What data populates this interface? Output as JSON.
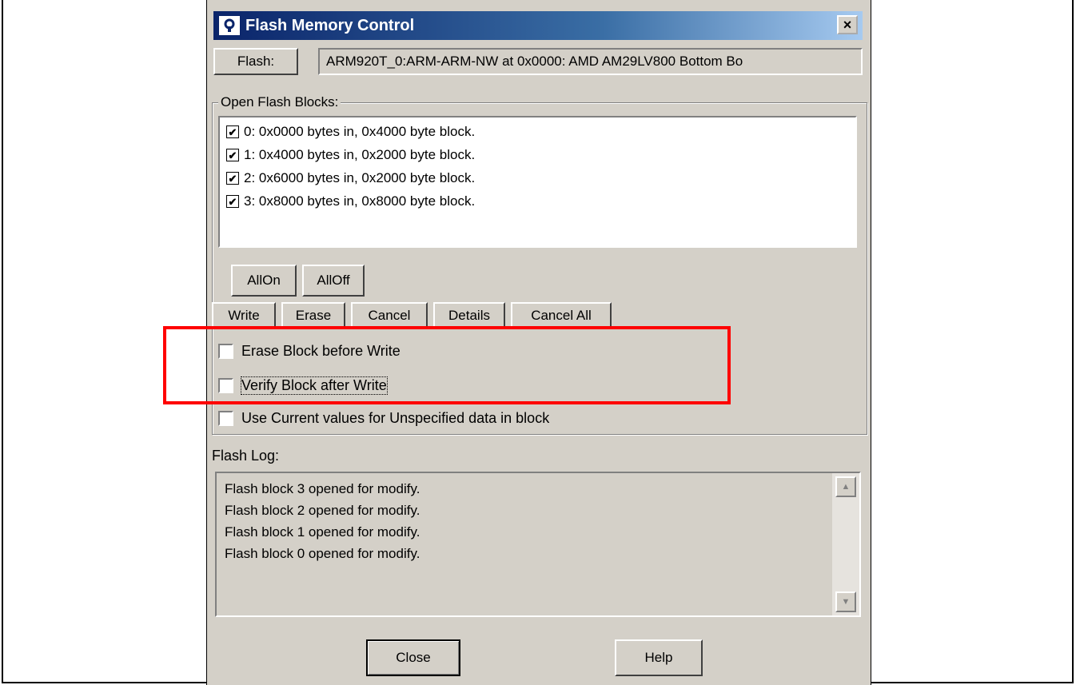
{
  "window": {
    "title": "Flash Memory Control",
    "close_glyph": "×"
  },
  "flash": {
    "button_label": "Flash:",
    "device_text": "ARM920T_0:ARM-ARM-NW at 0x0000: AMD AM29LV800 Bottom Bo"
  },
  "blocks": {
    "group_label": "Open Flash Blocks:",
    "items": [
      {
        "label": "0: 0x0000 bytes in, 0x4000 byte block.",
        "checked": true
      },
      {
        "label": "1: 0x4000 bytes in, 0x2000 byte block.",
        "checked": true
      },
      {
        "label": "2: 0x6000 bytes in, 0x2000 byte block.",
        "checked": true
      },
      {
        "label": "3: 0x8000 bytes in, 0x8000 byte block.",
        "checked": true
      }
    ],
    "check_glyph": "✔",
    "all_on_label": "AllOn",
    "all_off_label": "AllOff"
  },
  "actions": {
    "write": "Write",
    "erase": "Erase",
    "cancel": "Cancel",
    "details": "Details",
    "cancel_all": "Cancel All"
  },
  "options": {
    "erase_before_write": {
      "label": "Erase Block before Write",
      "checked": false
    },
    "verify_after_write": {
      "label": "Verify Block after Write",
      "checked": false
    },
    "use_current_values": {
      "label": "Use Current values for Unspecified data in block",
      "checked": false
    }
  },
  "log": {
    "label": "Flash Log:",
    "lines": [
      "Flash block 3 opened for modify.",
      "Flash block 2 opened for modify.",
      "Flash block 1 opened for modify.",
      "Flash block 0 opened for modify."
    ],
    "scroll_up_glyph": "▲",
    "scroll_down_glyph": "▼"
  },
  "footer": {
    "close_label": "Close",
    "help_label": "Help"
  },
  "colors": {
    "highlight_box": "#ff0000",
    "titlebar": "#0a246a",
    "dialog_bg": "#d4d0c8"
  }
}
